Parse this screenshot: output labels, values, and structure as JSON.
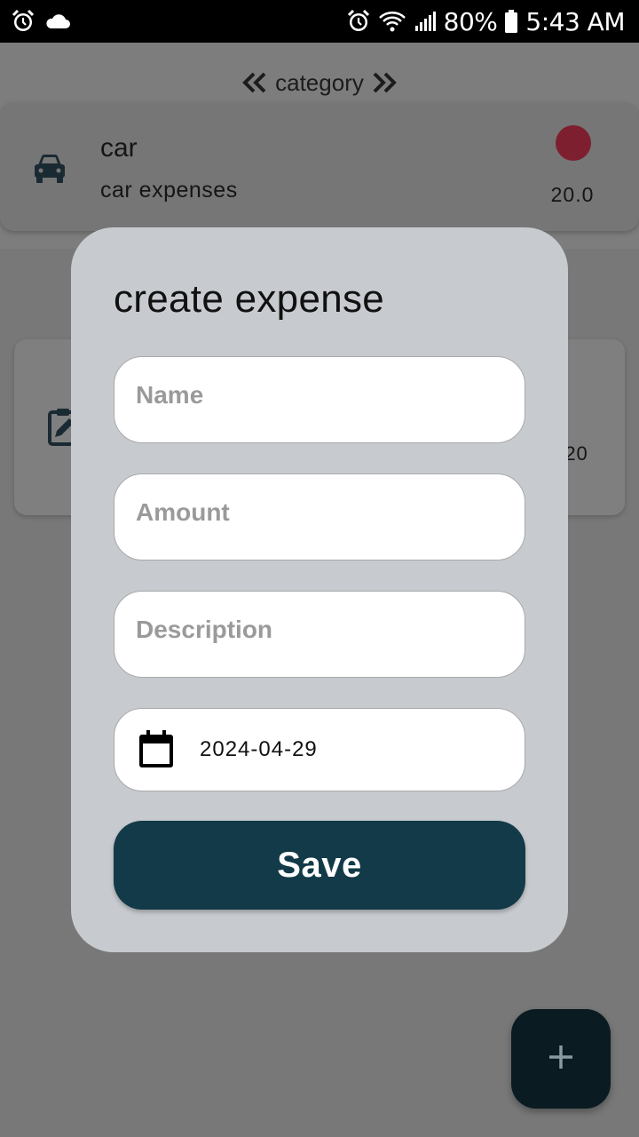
{
  "status_bar": {
    "battery_percent": "80%",
    "time": "5:43 AM",
    "left_icons": [
      "alarm-icon",
      "cloud-icon"
    ],
    "right_icons": [
      "alarm-icon",
      "wifi-icon",
      "signal-icon",
      "battery-icon"
    ]
  },
  "category_nav": {
    "label": "category",
    "prev_icon": "double-chevron-left-icon",
    "next_icon": "double-chevron-right-icon"
  },
  "category_card": {
    "icon": "car-icon",
    "name": "car",
    "description": "car expenses",
    "color": "#7d1f2f",
    "amount": "20.0"
  },
  "expense_card": {
    "icon": "edit-clipboard-icon",
    "date_partial": "-20"
  },
  "dialog": {
    "title": "create expense",
    "name_placeholder": "Name",
    "amount_placeholder": "Amount",
    "description_placeholder": "Description",
    "date_icon": "calendar-icon",
    "date_value": "2024-04-29",
    "save_label": "Save"
  },
  "fab": {
    "icon": "plus-icon"
  },
  "colors": {
    "primary": "#133a48",
    "dialog_bg": "#c7cbcf",
    "fab_bg": "#0a1b22"
  }
}
